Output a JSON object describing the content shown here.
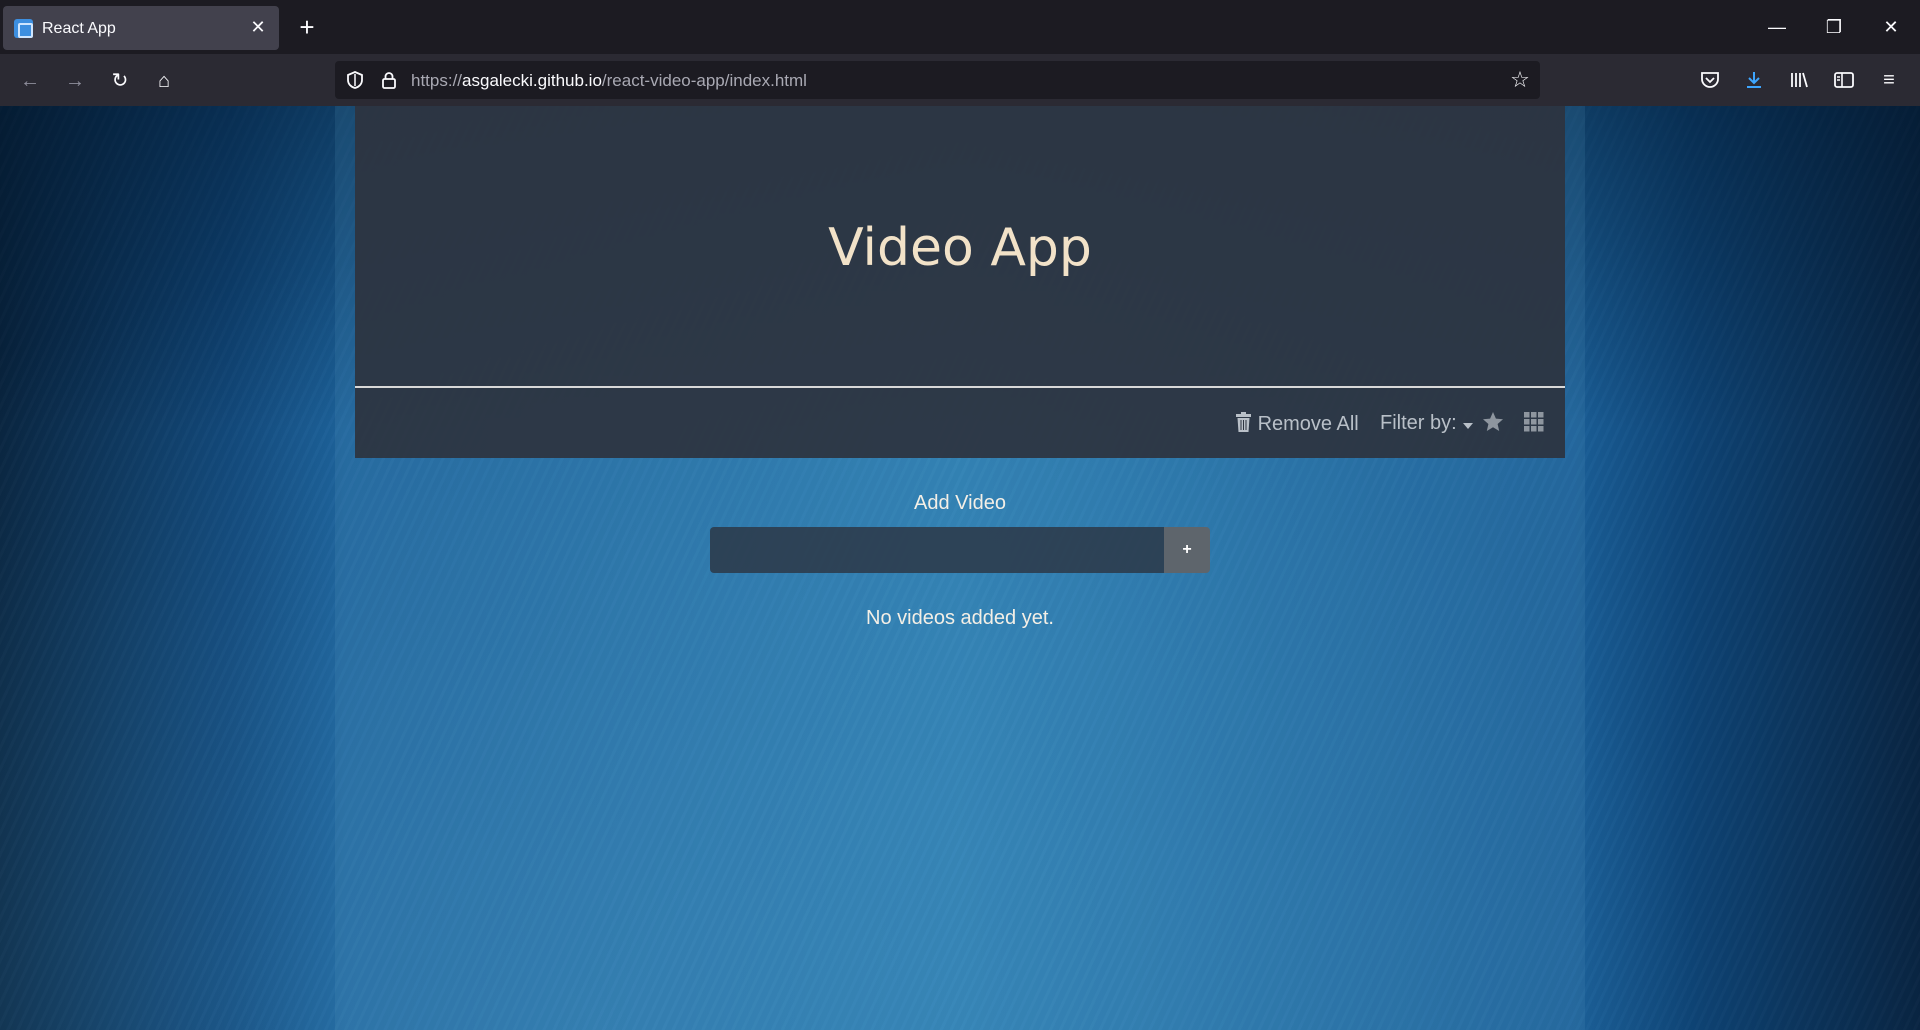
{
  "browser": {
    "tab": {
      "title": "React App",
      "close": "✕"
    },
    "new_tab": "+",
    "window": {
      "minimize": "—",
      "restore": "❐",
      "close": "✕"
    },
    "nav": {
      "back": "←",
      "forward": "→",
      "reload": "↻",
      "home": "⌂"
    },
    "url": {
      "scheme": "https://",
      "host": "asgalecki.github.io",
      "path": "/react-video-app/index.html"
    },
    "bookmark_star": "☆",
    "tools": {
      "pocket": "pocket-icon",
      "downloads": "download-icon",
      "library": "library-icon",
      "sidebar": "sidebar-icon",
      "menu": "≡"
    },
    "accent": "#3ea6ff"
  },
  "app": {
    "title": "Video App",
    "toolbar": {
      "remove_all": "Remove All",
      "filter_by": "Filter by:",
      "favorites_icon": "star-icon",
      "grid_icon": "grid-icon"
    },
    "add_video": {
      "label": "Add Video",
      "input_value": "",
      "button": "+"
    },
    "empty_message": "No videos added yet."
  }
}
